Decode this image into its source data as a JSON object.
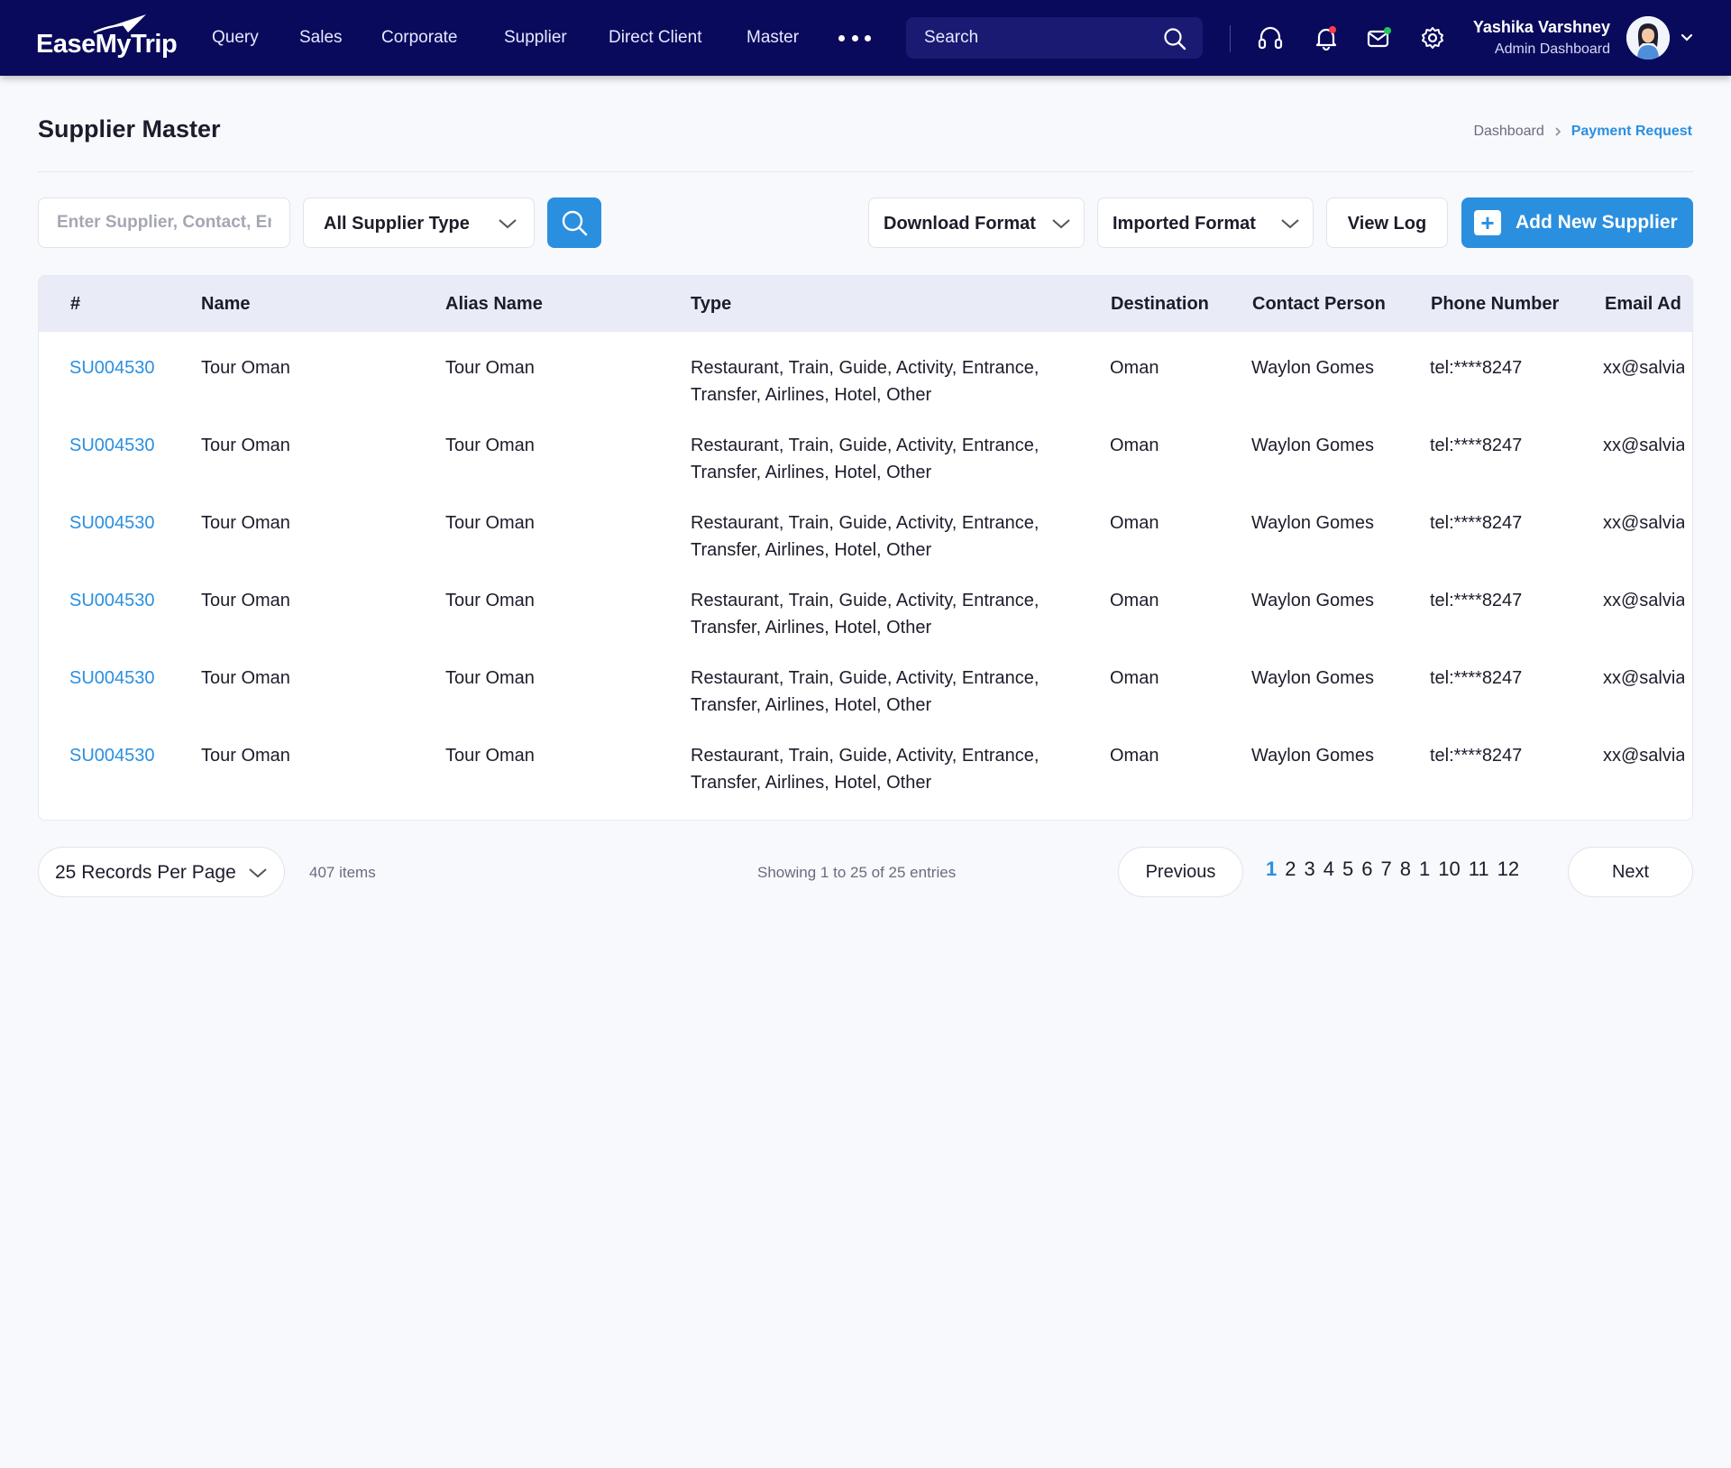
{
  "brand": {
    "logo_text": "EaseMyTrip"
  },
  "nav": {
    "items": [
      "Query",
      "Sales",
      "Corporate",
      "Supplier",
      "Direct Client",
      "Master"
    ],
    "search_placeholder": "Search"
  },
  "user": {
    "name": "Yashika Varshney",
    "role": "Admin Dashboard"
  },
  "page": {
    "title": "Supplier Master"
  },
  "breadcrumb": {
    "home": "Dashboard",
    "current": "Payment Request"
  },
  "filters": {
    "search_placeholder": "Enter Supplier, Contact, Email",
    "supplier_type": "All Supplier Type",
    "download_format": "Download Format",
    "imported_format": "Imported Format",
    "view_log": "View Log",
    "add_new": "Add New Supplier"
  },
  "table": {
    "columns": [
      "#",
      "Name",
      "Alias Name",
      "Type",
      "Destination",
      "Contact Person",
      "Phone Number",
      "Email Ad"
    ],
    "rows": [
      {
        "id": "SU004530",
        "name": "Tour Oman",
        "alias": "Tour Oman",
        "type": "Restaurant, Train, Guide, Activity, Entrance, Transfer, Airlines, Hotel, Other",
        "destination": "Oman",
        "contact": "Waylon Gomes",
        "phone": "tel:****8247",
        "email": "xx@salvia"
      },
      {
        "id": "SU004530",
        "name": "Tour Oman",
        "alias": "Tour Oman",
        "type": "Restaurant, Train, Guide, Activity, Entrance, Transfer, Airlines, Hotel, Other",
        "destination": "Oman",
        "contact": "Waylon Gomes",
        "phone": "tel:****8247",
        "email": "xx@salvia"
      },
      {
        "id": "SU004530",
        "name": "Tour Oman",
        "alias": "Tour Oman",
        "type": "Restaurant, Train, Guide, Activity, Entrance, Transfer, Airlines, Hotel, Other",
        "destination": "Oman",
        "contact": "Waylon Gomes",
        "phone": "tel:****8247",
        "email": "xx@salvia"
      },
      {
        "id": "SU004530",
        "name": "Tour Oman",
        "alias": "Tour Oman",
        "type": "Restaurant, Train, Guide, Activity, Entrance, Transfer, Airlines, Hotel, Other",
        "destination": "Oman",
        "contact": "Waylon Gomes",
        "phone": "tel:****8247",
        "email": "xx@salvia"
      },
      {
        "id": "SU004530",
        "name": "Tour Oman",
        "alias": "Tour Oman",
        "type": "Restaurant, Train, Guide, Activity, Entrance, Transfer, Airlines, Hotel, Other",
        "destination": "Oman",
        "contact": "Waylon Gomes",
        "phone": "tel:****8247",
        "email": "xx@salvia"
      },
      {
        "id": "SU004530",
        "name": "Tour Oman",
        "alias": "Tour Oman",
        "type": "Restaurant, Train, Guide, Activity, Entrance, Transfer, Airlines, Hotel, Other",
        "destination": "Oman",
        "contact": "Waylon Gomes",
        "phone": "tel:****8247",
        "email": "xx@salvia"
      }
    ]
  },
  "pagination": {
    "per_page": "25 Records Per Page",
    "items": "407 items",
    "showing": "Showing 1 to 25 of 25 entries",
    "previous": "Previous",
    "next": "Next",
    "pages": [
      "1",
      "2",
      "3",
      "4",
      "5",
      "6",
      "7",
      "8",
      "1",
      "10",
      "11",
      "12"
    ],
    "active_page": "1"
  },
  "colors": {
    "nav_bg": "#0a0a5c",
    "accent": "#2b8fe0",
    "notification_dot": "#ff3b4e",
    "mail_dot": "#22c55e"
  },
  "icons": [
    "search-icon",
    "headset-icon",
    "bell-icon",
    "mail-icon",
    "gear-icon",
    "chevron-down-icon",
    "plus-icon"
  ]
}
